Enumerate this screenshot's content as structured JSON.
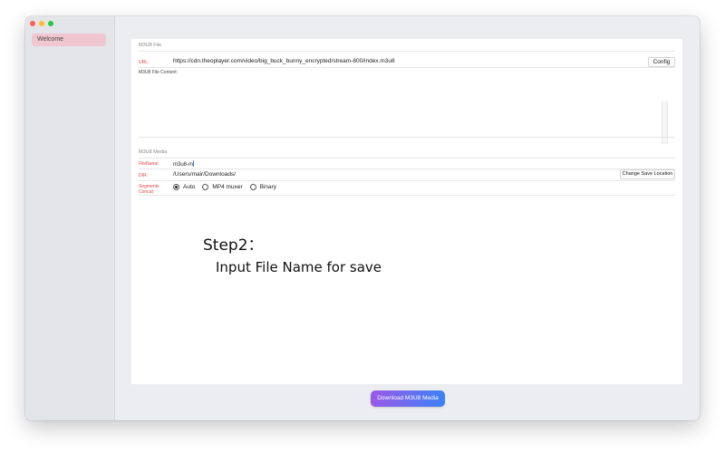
{
  "sidebar": {
    "items": [
      {
        "label": "Welcome",
        "selected": true
      }
    ]
  },
  "m3u8_file": {
    "section_title": "M3U8 File",
    "url_label": "URL:",
    "url_value": "https://cdn.theoplayer.com/video/big_buck_bunny_encrypted/stream-800/index.m3u8",
    "config_button": "Config",
    "content_label": "M3U8 File Content:",
    "content_value": ""
  },
  "m3u8_media": {
    "section_title": "M3U8 Media",
    "filename_label": "FileName:",
    "filename_value": "m3u8-m",
    "dir_label": "DIR:",
    "dir_value": "/Users/mair/Downloads/",
    "change_location_button": "Change Save Location",
    "segments_label_line1": "Segments",
    "segments_label_line2": "Concat:",
    "concat_options": [
      {
        "label": "Auto",
        "checked": true
      },
      {
        "label": "MP4 muxer",
        "checked": false
      },
      {
        "label": "Binary",
        "checked": false
      }
    ]
  },
  "overlay": {
    "step_title": "Step2：",
    "step_desc": "Input File Name for save"
  },
  "download_button": "Download M3U8 Media",
  "colors": {
    "accent_red": "#e0474c",
    "sidebar_selected": "#f0c7d0",
    "button_gradient_start": "#9b59e8",
    "button_gradient_end": "#3b82f6"
  }
}
